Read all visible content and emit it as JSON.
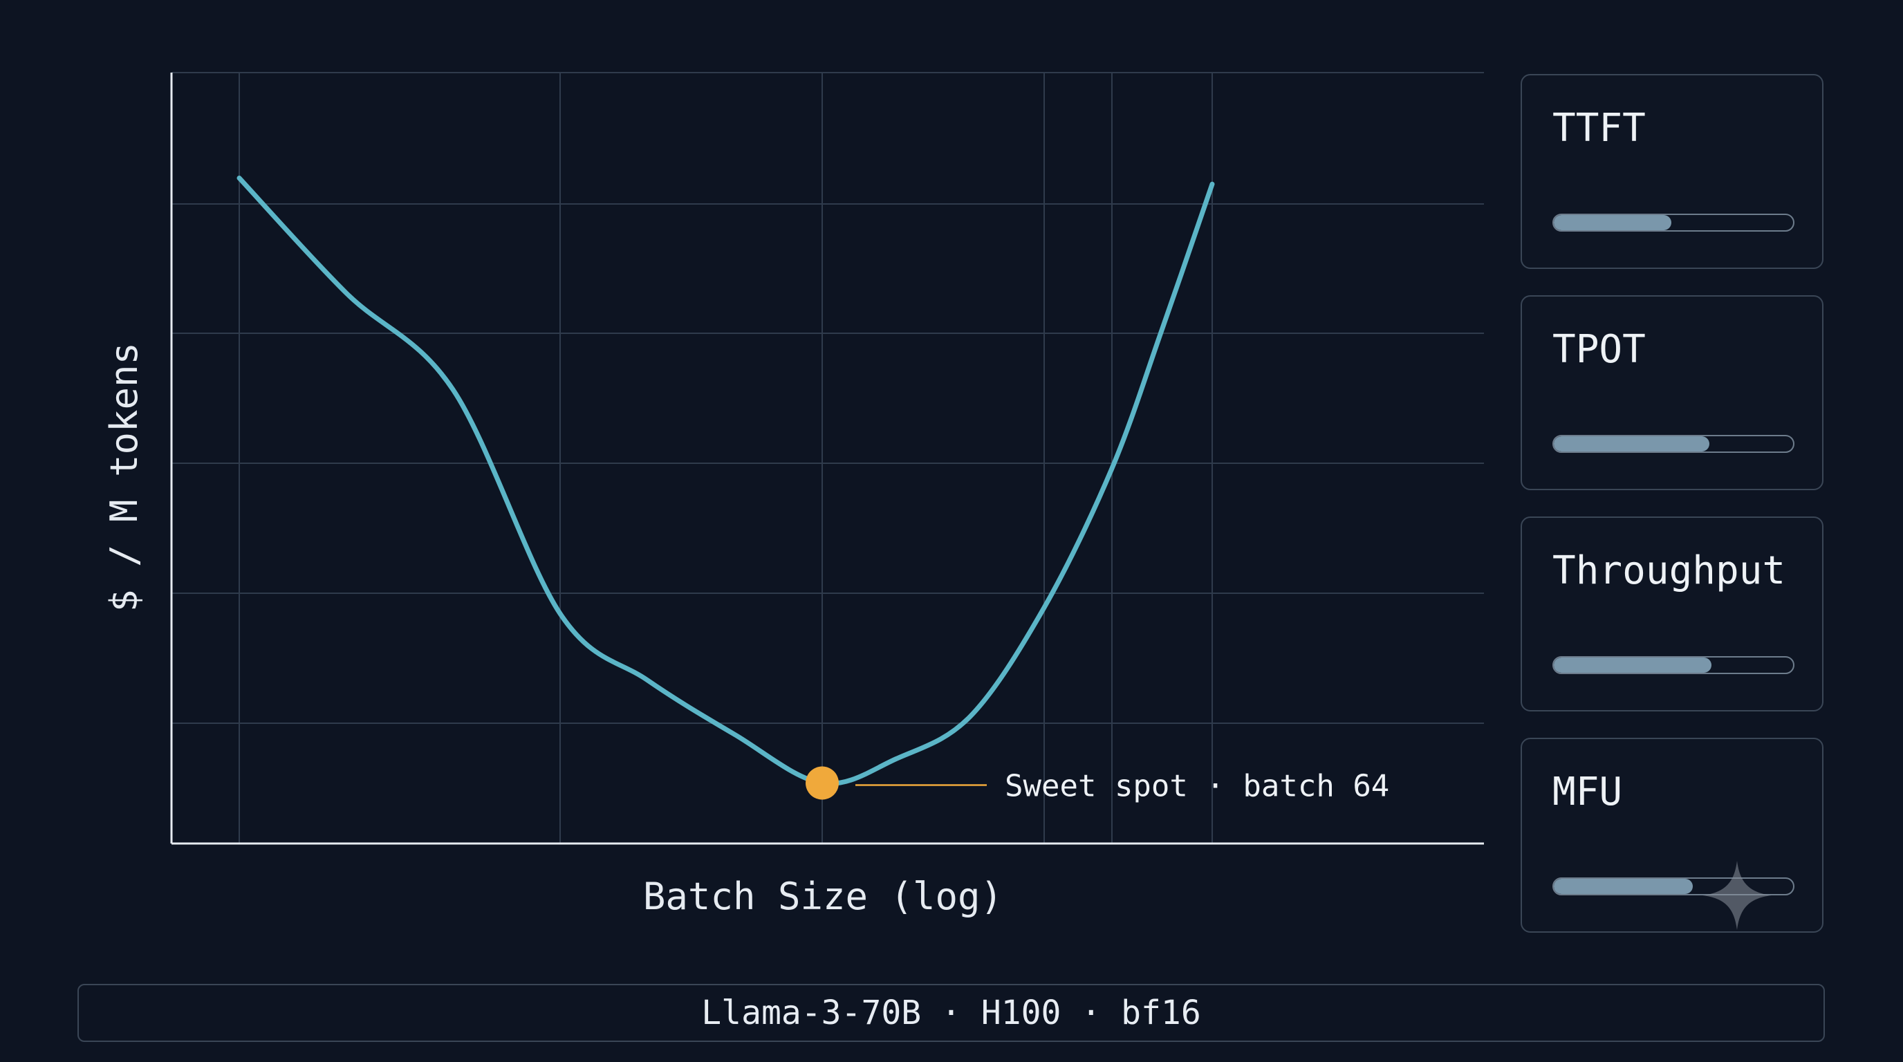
{
  "chart_data": {
    "type": "line",
    "title": "",
    "xlabel": "Batch Size (log)",
    "ylabel": "$ / M tokens",
    "x_scale": "log",
    "x_ticks": [
      1,
      8,
      64,
      512,
      1024,
      4096
    ],
    "xlim": [
      1,
      4096
    ],
    "ylim": [
      0,
      6
    ],
    "grid": true,
    "series": [
      {
        "color": "#5bb5c7",
        "x": [
          1,
          2,
          4,
          8,
          16,
          32,
          64,
          128,
          256,
          512,
          1024,
          2048,
          4096
        ],
        "y": [
          5.5,
          4.55,
          3.75,
          1.9,
          1.35,
          0.9,
          0.5,
          0.7,
          1.05,
          1.95,
          3.1,
          4.25,
          5.45
        ]
      }
    ],
    "annotations": [
      {
        "text": "Sweet spot · batch 64",
        "x": 64,
        "y": 0.5,
        "marker_color": "#f0a93b"
      }
    ]
  },
  "metrics": [
    {
      "label": "TTFT",
      "value": 0.49
    },
    {
      "label": "TPOT",
      "value": 0.65
    },
    {
      "label": "Throughput",
      "value": 0.66
    },
    {
      "label": "MFU",
      "value": 0.58
    }
  ],
  "footer": {
    "text": "Llama-3-70B · H100 · bf16"
  },
  "colors": {
    "background": "#0d1422",
    "curve": "#5bb5c7",
    "sweet_spot": "#f0a93b",
    "bar_fill": "#7a97ab",
    "border": "#3a4656"
  }
}
